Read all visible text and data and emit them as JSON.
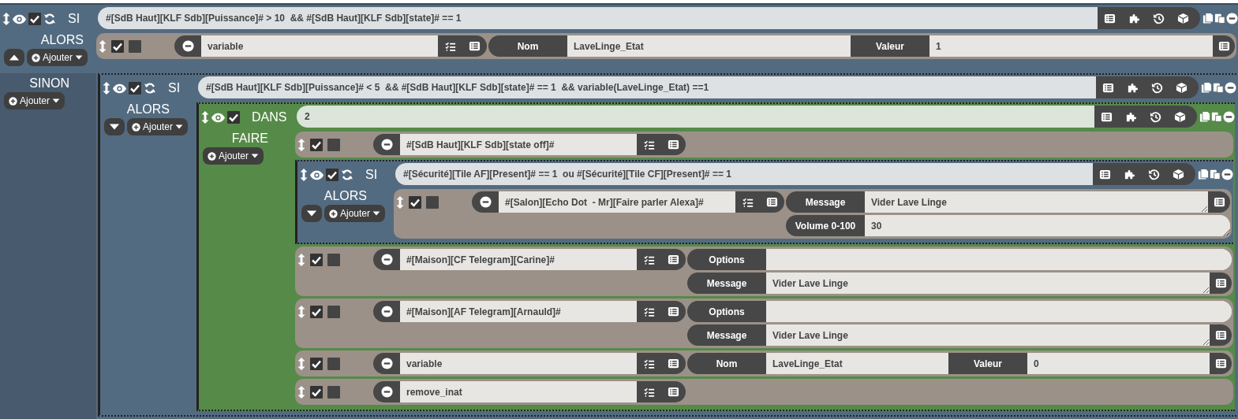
{
  "scenario": {
    "blocks": [
      {
        "kind": "si",
        "enabled": true,
        "label": "SI",
        "condition": "#[SdB Haut][KLF Sdb][Puissance]# > 10  && #[SdB Haut][KLF Sdb][state]# == 1",
        "sections": [
          {
            "kind": "then",
            "label": "ALORS",
            "expanded": true,
            "add": "Ajouter",
            "items": [
              {
                "kind": "action",
                "enabled": true,
                "parallel": false,
                "command": "variable",
                "options": [
                  {
                    "fields": [
                      {
                        "label": "Nom",
                        "value": "LaveLinge_Etat"
                      },
                      {
                        "label": "Valeur",
                        "value": "1"
                      }
                    ],
                    "picker": true
                  }
                ]
              }
            ]
          },
          {
            "kind": "else",
            "label": "SINON",
            "add": "Ajouter",
            "items": [
              {
                "kind": "si",
                "enabled": true,
                "label": "SI",
                "condition": "#[SdB Haut][KLF Sdb][Puissance]# < 5  && #[SdB Haut][KLF Sdb][state]# == 1  && variable(LaveLinge_Etat) ==1",
                "sections": [
                  {
                    "kind": "then",
                    "label": "ALORS",
                    "expanded": false,
                    "add": "Ajouter",
                    "items": [
                      {
                        "kind": "dans",
                        "enabled": true,
                        "label": "DANS",
                        "condition": "2",
                        "sections": [
                          {
                            "kind": "then",
                            "label": "FAIRE",
                            "add": "Ajouter",
                            "items": [
                              {
                                "kind": "action",
                                "enabled": true,
                                "parallel": false,
                                "command": "#[SdB Haut][KLF Sdb][state off]#"
                              },
                              {
                                "kind": "si",
                                "enabled": true,
                                "label": "SI",
                                "condition": "#[Sécurité][Tile AF][Present]# == 1  ou #[Sécurité][Tile CF][Present]# == 1",
                                "sections": [
                                  {
                                    "kind": "then",
                                    "label": "ALORS",
                                    "expanded": false,
                                    "add": "Ajouter",
                                    "items": [
                                      {
                                        "kind": "action",
                                        "enabled": true,
                                        "parallel": false,
                                        "command": "#[Salon][Echo Dot  - Mr][Faire parler Alexa]#",
                                        "options": [
                                          {
                                            "fields": [
                                              {
                                                "label": "Message",
                                                "value": "Vider Lave Linge",
                                                "multiline": true
                                              }
                                            ],
                                            "picker": true
                                          },
                                          {
                                            "fields": [
                                              {
                                                "label": "Volume 0-100",
                                                "value": "30",
                                                "multiline": true
                                              }
                                            ],
                                            "picker": false
                                          }
                                        ]
                                      }
                                    ]
                                  }
                                ]
                              },
                              {
                                "kind": "action",
                                "enabled": true,
                                "parallel": false,
                                "command": "#[Maison][CF Telegram][Carine]#",
                                "options": [
                                  {
                                    "fields": [
                                      {
                                        "label": "Options"
                                      }
                                    ],
                                    "picker": false
                                  },
                                  {
                                    "fields": [
                                      {
                                        "label": "Message",
                                        "value": "Vider Lave Linge",
                                        "multiline": true
                                      }
                                    ],
                                    "picker": true
                                  }
                                ]
                              },
                              {
                                "kind": "action",
                                "enabled": true,
                                "parallel": false,
                                "command": "#[Maison][AF Telegram][Arnauld]#",
                                "options": [
                                  {
                                    "fields": [
                                      {
                                        "label": "Options"
                                      }
                                    ],
                                    "picker": false
                                  },
                                  {
                                    "fields": [
                                      {
                                        "label": "Message",
                                        "value": "Vider Lave Linge",
                                        "multiline": true
                                      }
                                    ],
                                    "picker": true
                                  }
                                ]
                              },
                              {
                                "kind": "action",
                                "enabled": true,
                                "parallel": false,
                                "command": "variable",
                                "options": [
                                  {
                                    "fields": [
                                      {
                                        "label": "Nom",
                                        "value": "LaveLinge_Etat"
                                      },
                                      {
                                        "label": "Valeur",
                                        "value": "0"
                                      }
                                    ],
                                    "picker": true
                                  }
                                ]
                              },
                              {
                                "kind": "action",
                                "enabled": true,
                                "parallel": false,
                                "command": "remove_inat"
                              }
                            ]
                          }
                        ]
                      }
                    ]
                  }
                ]
              }
            ]
          }
        ]
      }
    ]
  }
}
